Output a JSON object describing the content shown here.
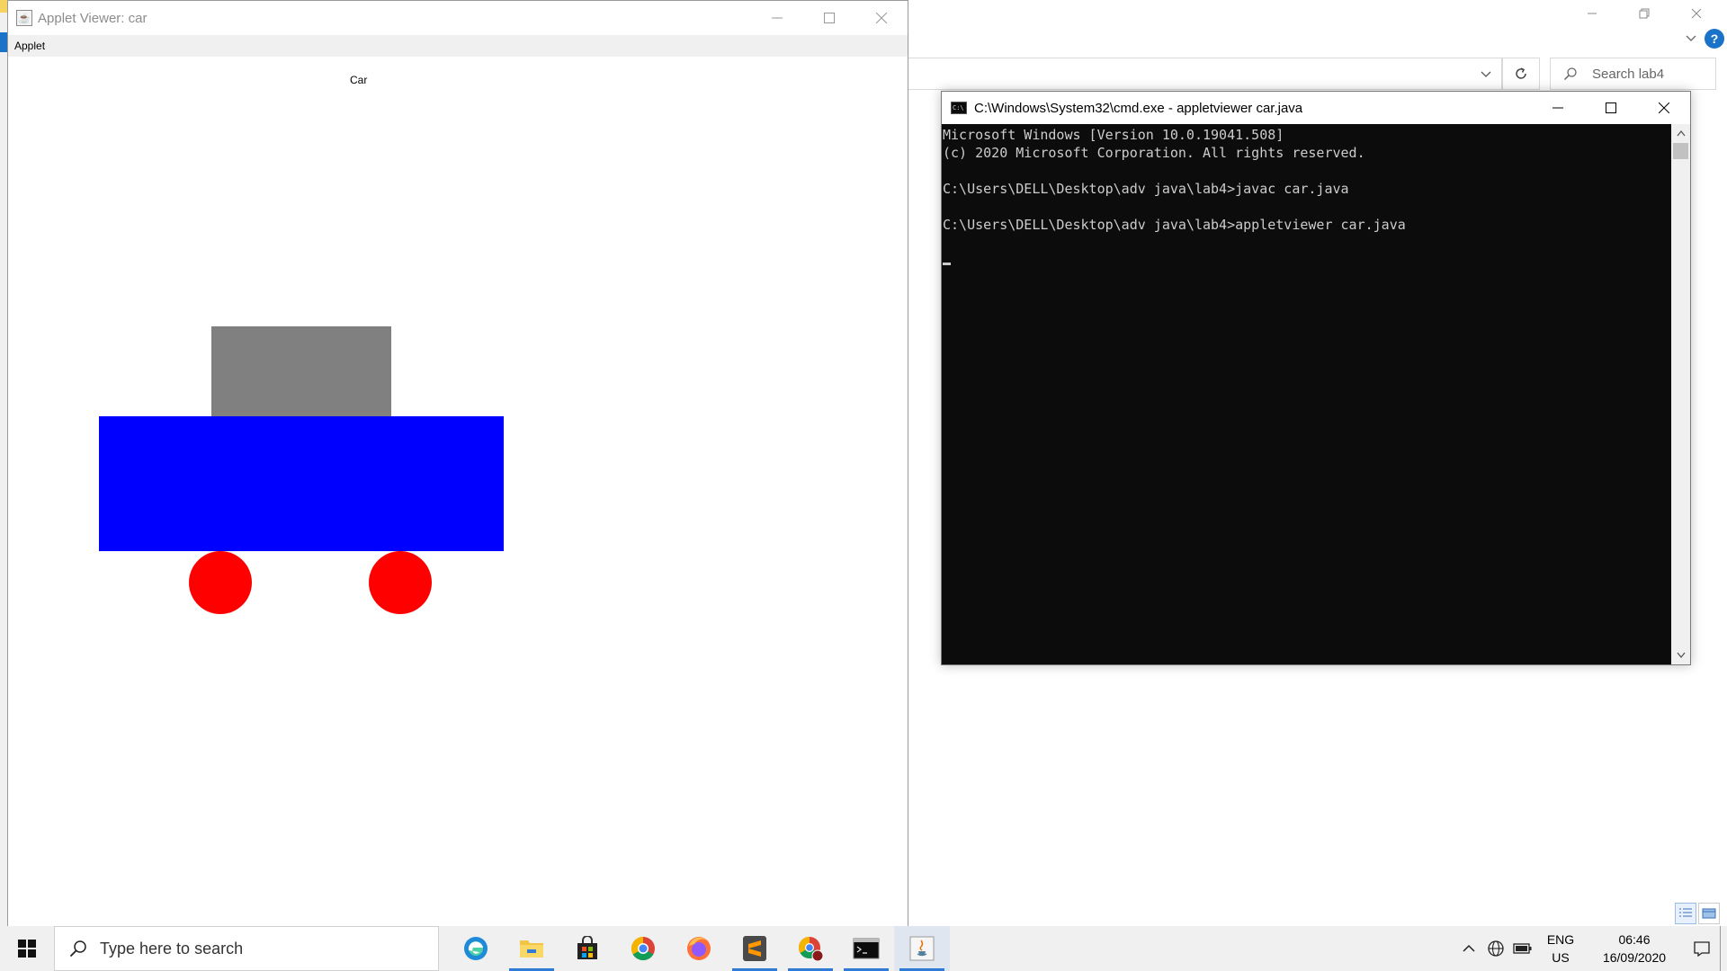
{
  "applet_window": {
    "title": "Applet Viewer: car",
    "menu": [
      "Applet"
    ],
    "canvas_label": "Car",
    "colors": {
      "roof": "#808080",
      "body": "#0000ff",
      "wheels": "#ff0000"
    }
  },
  "cmd_window": {
    "title": "C:\\Windows\\System32\\cmd.exe - appletviewer  car.java",
    "lines": [
      "Microsoft Windows [Version 10.0.19041.508]",
      "(c) 2020 Microsoft Corporation. All rights reserved.",
      "",
      "C:\\Users\\DELL\\Desktop\\adv java\\lab4>javac car.java",
      "",
      "C:\\Users\\DELL\\Desktop\\adv java\\lab4>appletviewer car.java",
      ""
    ]
  },
  "explorer": {
    "search_placeholder": "Search lab4",
    "help_label": "?"
  },
  "taskbar": {
    "search_placeholder": "Type here to search",
    "apps": [
      {
        "icon": "edge-icon",
        "active": false,
        "running": false
      },
      {
        "icon": "file-explorer-icon",
        "active": false,
        "running": true
      },
      {
        "icon": "store-icon",
        "active": false,
        "running": false
      },
      {
        "icon": "chrome-icon",
        "active": false,
        "running": false
      },
      {
        "icon": "firefox-icon",
        "active": false,
        "running": false
      },
      {
        "icon": "sublime-text-icon",
        "active": false,
        "running": true
      },
      {
        "icon": "chrome-profile-icon",
        "active": false,
        "running": true
      },
      {
        "icon": "cmd-icon",
        "active": false,
        "running": true
      },
      {
        "icon": "java-icon",
        "active": true,
        "running": true
      }
    ],
    "lang_primary": "ENG",
    "lang_secondary": "US",
    "time": "06:46",
    "date": "16/09/2020"
  }
}
